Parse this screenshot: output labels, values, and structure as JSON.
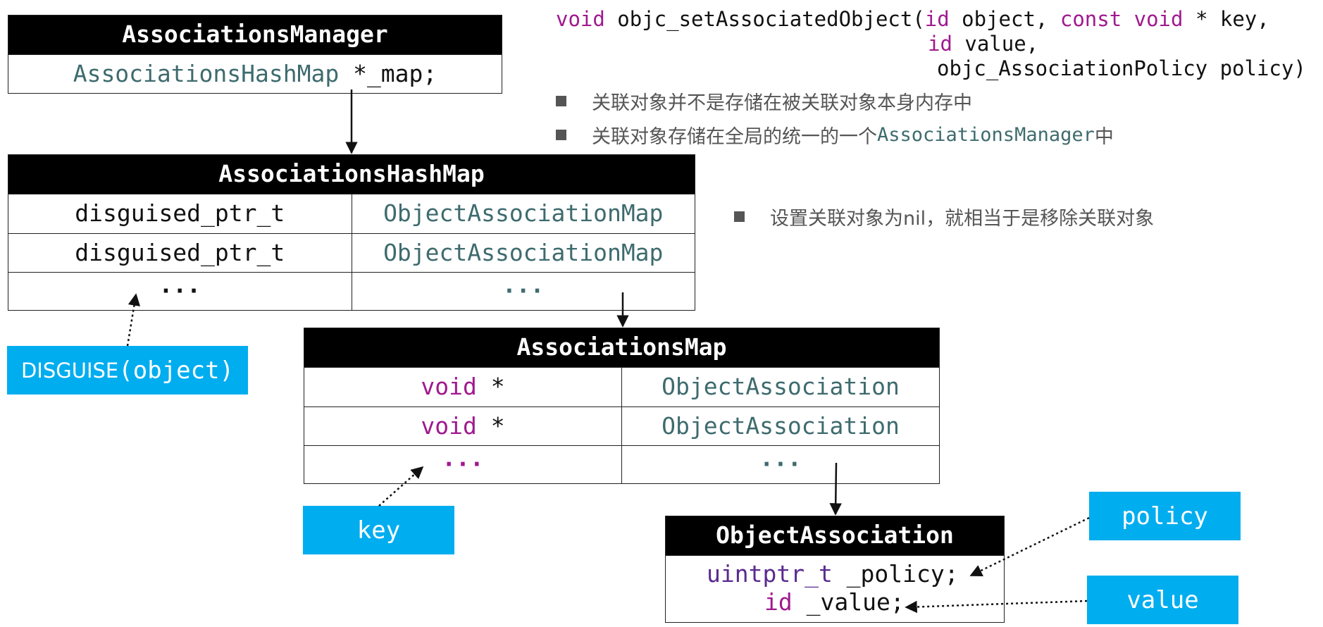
{
  "signature": {
    "line1_void": "void",
    "line1_name": " objc_setAssociatedObject(",
    "line1_id": "id",
    "line1_object": " object, ",
    "line1_const": "const",
    "line1_sp": " ",
    "line1_void2": "void",
    "line1_key": " * key,",
    "line2_id": "id",
    "line2_value": " value,",
    "line3": "objc_AssociationPolicy policy)"
  },
  "bullets": [
    {
      "text": "关联对象并不是存储在被关联对象本身内存中"
    },
    {
      "prefix": "关联对象存储在全局的统一的一个",
      "mono": "AssociationsManager",
      "suffix": "中"
    },
    {
      "text": "设置关联对象为nil，就相当于是移除关联对象"
    }
  ],
  "associations_manager": {
    "title": "AssociationsManager",
    "field_type": "AssociationsHashMap",
    "field_name": " *_map;"
  },
  "associations_hashmap": {
    "title": "AssociationsHashMap",
    "rows": [
      {
        "key": "disguised_ptr_t",
        "value": "ObjectAssociationMap"
      },
      {
        "key": "disguised_ptr_t",
        "value": "ObjectAssociationMap"
      },
      {
        "key": "···",
        "value": "···"
      }
    ]
  },
  "associations_map": {
    "title": "AssociationsMap",
    "rows": [
      {
        "key_kw": "void",
        "key_rest": " *",
        "value": "ObjectAssociation"
      },
      {
        "key_kw": "void",
        "key_rest": " *",
        "value": "ObjectAssociation"
      },
      {
        "key_kw": "···",
        "key_rest": "",
        "value": "···"
      }
    ]
  },
  "object_association": {
    "title": "ObjectAssociation",
    "policy_type": "uintptr_t",
    "policy_name": " _policy;",
    "value_type": "id",
    "value_name": " _value;"
  },
  "tags": {
    "disguise_prefix": "DISGUISE",
    "disguise_arg": "(object)",
    "key": "key",
    "policy": "policy",
    "value": "value"
  },
  "colors": {
    "tag_bg": "#00adef",
    "keyword": "#a0198f",
    "type": "#3e6b6e",
    "uint_type": "#5a2a90"
  }
}
